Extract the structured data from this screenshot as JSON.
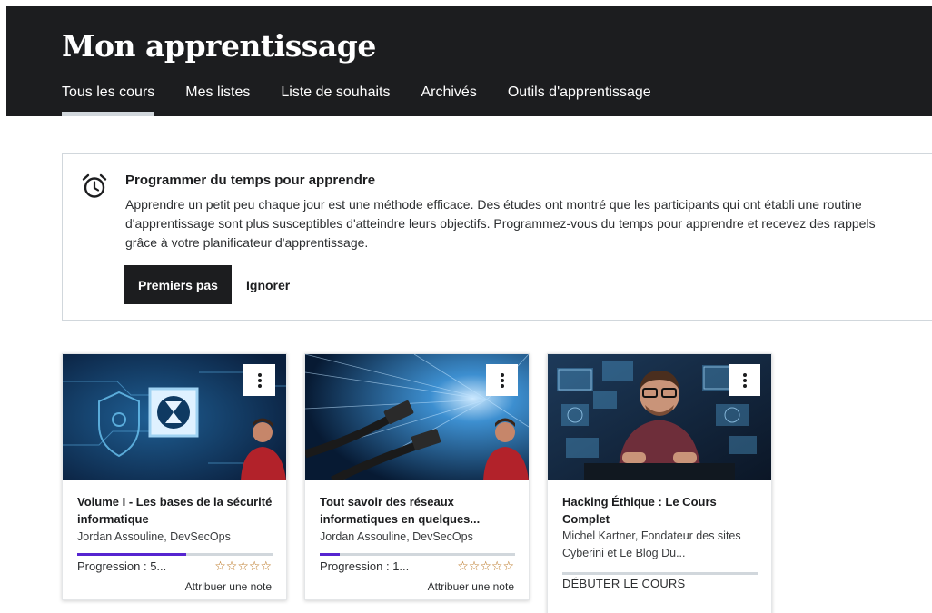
{
  "header": {
    "title": "Mon apprentissage",
    "tabs": [
      {
        "label": "Tous les cours",
        "active": true
      },
      {
        "label": "Mes listes"
      },
      {
        "label": "Liste de souhaits"
      },
      {
        "label": "Archivés"
      },
      {
        "label": "Outils d'apprentissage"
      }
    ]
  },
  "banner": {
    "icon": "alarm-clock-icon",
    "title": "Programmer du temps pour apprendre",
    "text": "Apprendre un petit peu chaque jour est une méthode efficace. Des études ont montré que les participants qui ont établi une routine d'apprentissage sont plus susceptibles d'atteindre leurs objectifs. Programmez-vous du temps pour apprendre et recevez des rappels grâce à votre planificateur d'apprentissage.",
    "primary_button": "Premiers pas",
    "secondary_button": "Ignorer"
  },
  "courses": [
    {
      "title": "Volume I - Les bases de la sécurité informatique",
      "author": "Jordan Assouline, DevSecOps",
      "progress_label": "Progression : 5...",
      "progress": 0.56,
      "stars": "☆☆☆☆☆",
      "rate_label": "Attribuer une note"
    },
    {
      "title": "Tout savoir des réseaux informatiques en quelques...",
      "author": "Jordan Assouline, DevSecOps",
      "progress_label": "Progression : 1...",
      "progress": 0.1,
      "stars": "☆☆☆☆☆",
      "rate_label": "Attribuer une note"
    },
    {
      "title": "Hacking Éthique : Le Cours Complet",
      "author": "Michel Kartner, Fondateur des sites Cyberini et Le Blog Du...",
      "start_label": "DÉBUTER LE COURS"
    }
  ],
  "colors": {
    "header_bg": "#1c1d1f",
    "progress": "#5624d0",
    "stars": "#b4690e",
    "border": "#d1d7dc"
  }
}
